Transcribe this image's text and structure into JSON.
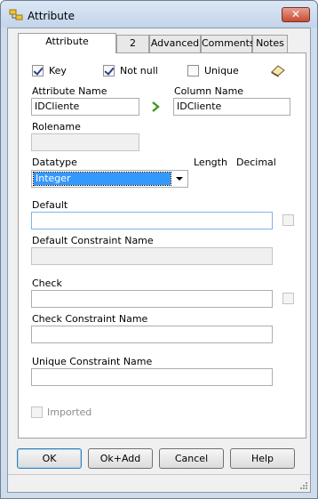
{
  "window": {
    "title": "Attribute",
    "close_label": "✕"
  },
  "tabs": [
    {
      "label": "Attribute",
      "active": true
    },
    {
      "label": "2",
      "active": false
    },
    {
      "label": "Advanced",
      "active": false
    },
    {
      "label": "Comments",
      "active": false
    },
    {
      "label": "Notes",
      "active": false
    }
  ],
  "flags": {
    "key_label": "Key",
    "key_checked": true,
    "notnull_label": "Not null",
    "notnull_checked": true,
    "unique_label": "Unique",
    "unique_checked": false
  },
  "icons": {
    "eraser": "eraser-icon",
    "arrow": "arrow-right-icon",
    "title": "attribute-icon"
  },
  "fields": {
    "attribute_name_label": "Attribute Name",
    "attribute_name_value": "IDCliente",
    "column_name_label": "Column Name",
    "column_name_value": "IDCliente",
    "rolename_label": "Rolename",
    "rolename_value": "",
    "datatype_label": "Datatype",
    "datatype_value": "Integer",
    "length_label": "Length",
    "decimal_label": "Decimal",
    "default_label": "Default",
    "default_value": "",
    "default_constraint_label": "Default Constraint Name",
    "default_constraint_value": "",
    "check_label": "Check",
    "check_value": "",
    "check_constraint_label": "Check Constraint Name",
    "check_constraint_value": "",
    "unique_constraint_label": "Unique Constraint Name",
    "unique_constraint_value": "",
    "imported_label": "Imported"
  },
  "buttons": {
    "ok": "OK",
    "okadd": "Ok+Add",
    "cancel": "Cancel",
    "help": "Help"
  },
  "colors": {
    "selection": "#3399ff",
    "arrow_green": "#3c9a1f",
    "frame": "#cfdcec"
  }
}
